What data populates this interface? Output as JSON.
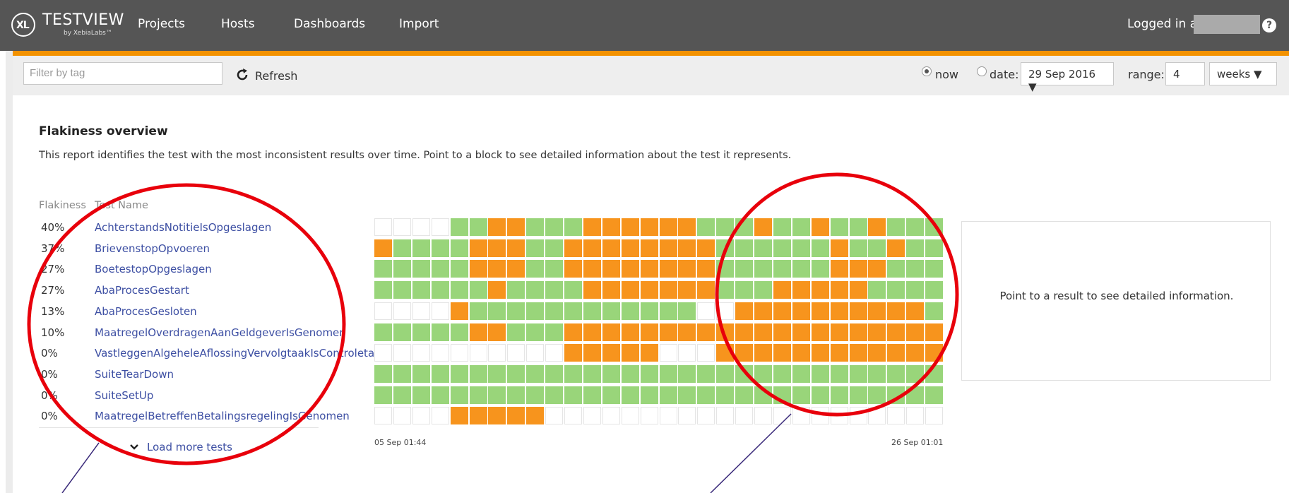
{
  "app": {
    "logo_text": "TESTVIEW",
    "logo_sub": "by XebiaLabs™",
    "logo_mark": "XL"
  },
  "nav": {
    "items": [
      "Projects",
      "Hosts",
      "Dashboards",
      "Import"
    ],
    "logged_in_label": "Logged in as",
    "help_label": "?"
  },
  "toolbar": {
    "filter_placeholder": "Filter by tag",
    "refresh_label": "Refresh",
    "now_label": "now",
    "date_label": "date:",
    "date_value": "29 Sep 2016 ▼",
    "range_label": "range:",
    "range_value": "4",
    "range_unit": "weeks ▼",
    "selected_mode": "now"
  },
  "report": {
    "title": "Flakiness overview",
    "description": "This report identifies the test with the most inconsistent results over time. Point to a block to see detailed information about the test it represents.",
    "col_flakiness": "Flakiness",
    "col_test_name": "Test Name",
    "load_more": "Load more tests",
    "axis_start": "05 Sep 01:44",
    "axis_end": "26 Sep 01:01",
    "detail_placeholder": "Point to a result to see detailed information."
  },
  "tests": [
    {
      "flakiness": "40%",
      "name": "AchterstandsNotitieIsOpgeslagen",
      "results": "eeeeggoogggoooooogggoggoggogggggggg"
    },
    {
      "flakiness": "37%",
      "name": "BrievenstopOpvoeren",
      "results": "oggggoooggooooooooggggggoggoggggogggg"
    },
    {
      "flakiness": "27%",
      "name": "BoetestopOpgeslagen",
      "results": "gggggoooggooooooooggggggooogggggogggg"
    },
    {
      "flakiness": "27%",
      "name": "AbaProcesGestart",
      "results": "ggggggoggggooooooogggoooooggggggogggg"
    },
    {
      "flakiness": "13%",
      "name": "AbaProcesGesloten",
      "results": "eeeeoggggggggggggeeoooooooooogggggg"
    },
    {
      "flakiness": "10%",
      "name": "MaatregelOverdragenAanGeldgeverIsGenomen",
      "results": "gggggoogggooooooooooooooooooooooooooo"
    },
    {
      "flakiness": "0%",
      "name": "VastleggenAlgeheleAflossingVervolgtaakIsControletaak",
      "results": "eeeeeeeeeeoooooeeeoooooooooooooooooooo"
    },
    {
      "flakiness": "0%",
      "name": "SuiteTearDown",
      "results": "gggggggggggggggggggggggggggggggggggggg"
    },
    {
      "flakiness": "0%",
      "name": "SuiteSetUp",
      "results": "gggggggggggggggggggggggggggggggggggggg"
    },
    {
      "flakiness": "0%",
      "name": "MaatregelBetreffenBetalingsregelingIsGenomen",
      "results": "eeeeoooooeeeeeeeeeeeeeeeeeeeeeeeeeeeee"
    }
  ],
  "colors": {
    "pass": "#99d57a",
    "fail": "#f7941d",
    "accent": "#f39200",
    "annotation": "#e8000b"
  }
}
